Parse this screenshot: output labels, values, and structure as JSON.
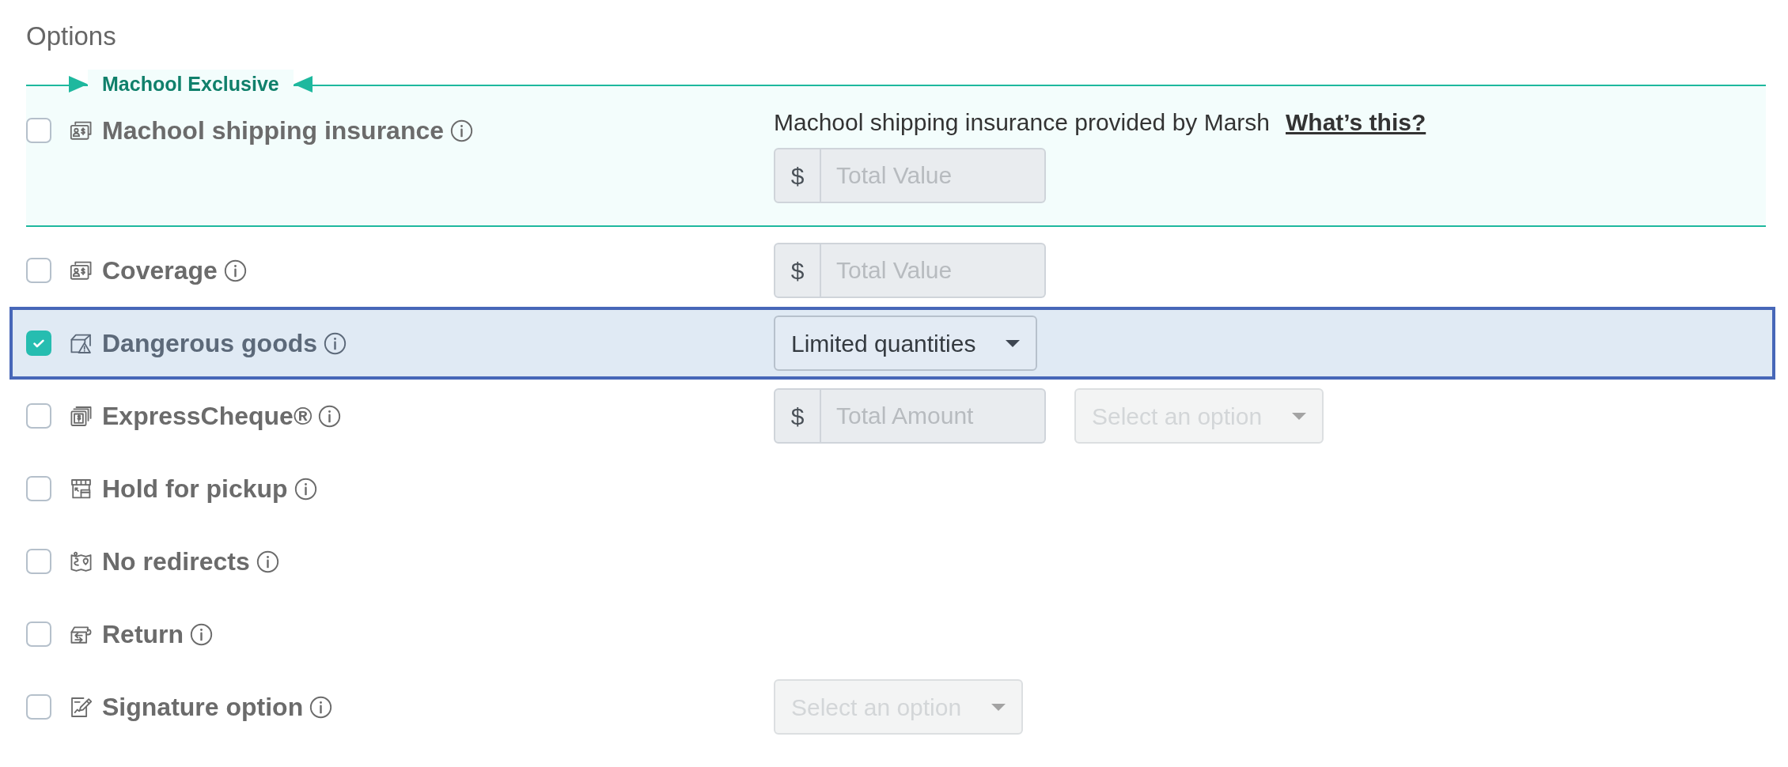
{
  "title": "Options",
  "exclusive": {
    "label": "Machool Exclusive",
    "option": {
      "label": "Machool shipping insurance",
      "checked": false
    },
    "description": "Machool shipping insurance provided by Marsh",
    "link": "What’s this?",
    "controls": [
      {
        "kind": "money",
        "prefix": "$",
        "placeholder": "Total Value",
        "disabled": true
      }
    ]
  },
  "rows": [
    {
      "label": "Coverage",
      "checked": false,
      "highlighted": false,
      "controls": [
        {
          "kind": "money",
          "prefix": "$",
          "placeholder": "Total Value",
          "disabled": true
        }
      ]
    },
    {
      "label": "Dangerous goods",
      "checked": true,
      "highlighted": true,
      "controls": [
        {
          "kind": "select",
          "value": "Limited quantities",
          "disabled": false
        }
      ]
    },
    {
      "label": "ExpressCheque®",
      "checked": false,
      "highlighted": false,
      "controls": [
        {
          "kind": "money",
          "prefix": "$",
          "placeholder": "Total Amount",
          "disabled": true
        },
        {
          "kind": "select",
          "placeholder": "Select an option",
          "disabled": true
        }
      ]
    },
    {
      "label": "Hold for pickup",
      "checked": false,
      "highlighted": false
    },
    {
      "label": "No redirects",
      "checked": false,
      "highlighted": false
    },
    {
      "label": "Return",
      "checked": false,
      "highlighted": false
    },
    {
      "label": "Signature option",
      "checked": false,
      "highlighted": false,
      "controls": [
        {
          "kind": "select",
          "placeholder": "Select an option",
          "disabled": true
        }
      ]
    }
  ]
}
